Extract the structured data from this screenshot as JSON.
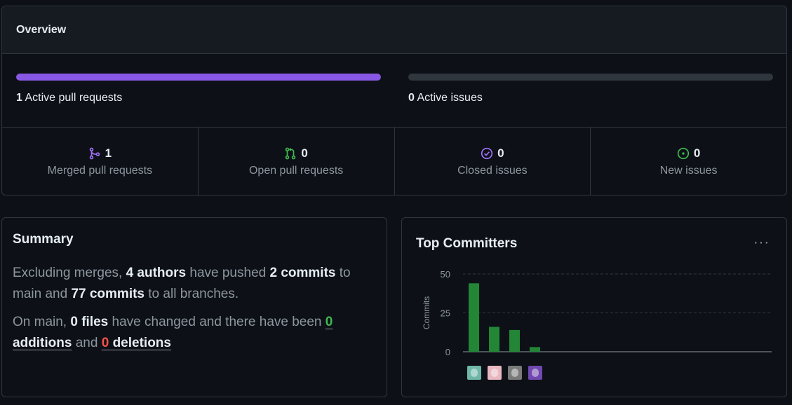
{
  "overview": {
    "title": "Overview",
    "pull_requests": {
      "count": "1",
      "label": "Active pull requests",
      "fill_fraction": 1.0,
      "color": "#8957e5"
    },
    "issues": {
      "count": "0",
      "label": "Active issues",
      "fill_fraction": 0.0,
      "color": "#30363d"
    },
    "stats": [
      {
        "value": "1",
        "label": "Merged pull requests",
        "icon": "merge-icon",
        "color": "#a371f7"
      },
      {
        "value": "0",
        "label": "Open pull requests",
        "icon": "pull-request-icon",
        "color": "#3fb950"
      },
      {
        "value": "0",
        "label": "Closed issues",
        "icon": "issue-closed-icon",
        "color": "#a371f7"
      },
      {
        "value": "0",
        "label": "New issues",
        "icon": "issue-opened-icon",
        "color": "#3fb950"
      }
    ]
  },
  "summary": {
    "title": "Summary",
    "p1": {
      "t1": "Excluding merges, ",
      "authors": "4 authors",
      "t2": " have pushed ",
      "commits_main": "2 commits",
      "t3": " to main and ",
      "commits_all": "77 commits",
      "t4": " to all branches."
    },
    "p2": {
      "t1": "On main, ",
      "files": "0 files",
      "t2": " have changed and there have been ",
      "additions_count": "0",
      "additions_label": "additions",
      "t3": " and ",
      "deletions_count": "0",
      "deletions_label": "deletions"
    }
  },
  "committers": {
    "title": "Top Committers",
    "more_label": "···"
  },
  "chart_data": {
    "type": "bar",
    "ylabel": "Commits",
    "ylim": [
      0,
      50
    ],
    "yticks": [
      0,
      25,
      50
    ],
    "grid": true,
    "values": [
      44,
      16,
      14,
      3
    ],
    "bar_color": "#238636",
    "avatar_colors": [
      "#6fb7a8",
      "#e8b8c0",
      "#7a7a7a",
      "#7048b0"
    ]
  }
}
